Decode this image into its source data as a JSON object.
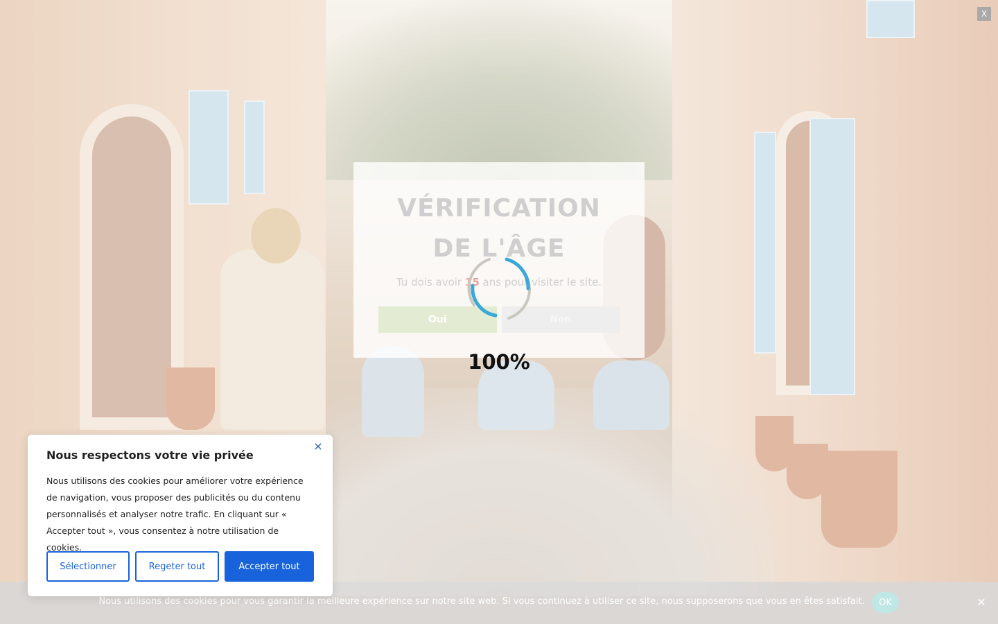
{
  "top_close": {
    "label": "X"
  },
  "age_gate": {
    "title": "VÉRIFICATION DE L'ÂGE",
    "subtitle_before": "Tu dois avoir",
    "age": "15",
    "subtitle_after": "ans pour visiter le site.",
    "yes_label": "Oui",
    "no_label": "Non",
    "loader_percent": "100%"
  },
  "cookie_consent": {
    "title": "Nous respectons votre vie privée",
    "close_label": "×",
    "text": "Nous utilisons des cookies pour améliorer votre expérience de navigation, vous proposer des publicités ou du contenu personnalisés et analyser notre trafic. En cliquant sur « Accepter tout », vous consentez à notre utilisation de cookies.",
    "select_label": "Sélectionner",
    "reject_label": "Regeter tout",
    "accept_label": "Accepter tout"
  },
  "notice_bar": {
    "text": "Nous utilisons des cookies pour vous garantir la meilleure expérience sur notre site web. Si vous continuez à utiliser ce site, nous supposerons que vous en êtes satisfait.",
    "ok_label": "OK",
    "close_label": "✕"
  },
  "colors": {
    "accent": "#1863dc",
    "loader_blue": "#3aa8d8",
    "loader_grey": "#c9c7bf"
  }
}
